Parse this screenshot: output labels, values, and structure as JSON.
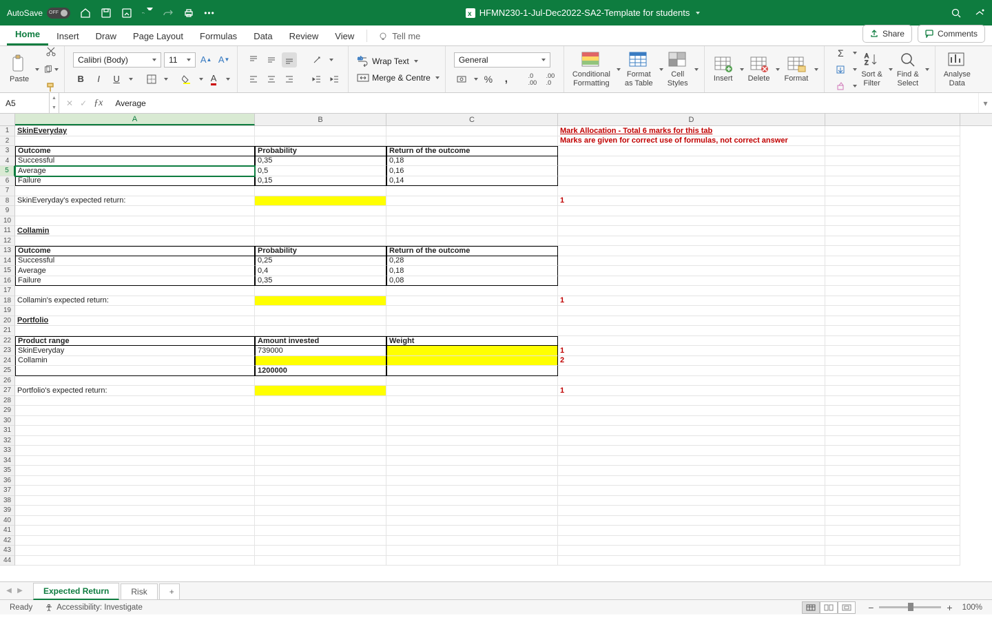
{
  "titlebar": {
    "autosave_label": "AutoSave",
    "autosave_state": "OFF",
    "doc_title": "HFMN230-1-Jul-Dec2022-SA2-Template for students"
  },
  "tabs": {
    "home": "Home",
    "insert": "Insert",
    "draw": "Draw",
    "page_layout": "Page Layout",
    "formulas": "Formulas",
    "data": "Data",
    "review": "Review",
    "view": "View",
    "tell_me": "Tell me",
    "share": "Share",
    "comments": "Comments"
  },
  "ribbon": {
    "paste": "Paste",
    "font_name": "Calibri (Body)",
    "font_size": "11",
    "wrap_text": "Wrap Text",
    "merge_centre": "Merge & Centre",
    "number_format": "General",
    "cond_fmt_l1": "Conditional",
    "cond_fmt_l2": "Formatting",
    "fmt_table_l1": "Format",
    "fmt_table_l2": "as Table",
    "cell_styles_l1": "Cell",
    "cell_styles_l2": "Styles",
    "insert": "Insert",
    "delete": "Delete",
    "format": "Format",
    "sort_filter_l1": "Sort &",
    "sort_filter_l2": "Filter",
    "find_select_l1": "Find &",
    "find_select_l2": "Select",
    "analyse_l1": "Analyse",
    "analyse_l2": "Data"
  },
  "namebox": "A5",
  "formula": "Average",
  "columns": [
    "A",
    "B",
    "C",
    "D"
  ],
  "col_widths": {
    "A": 348,
    "B": 191,
    "C": 249,
    "D": 388,
    "E": 196
  },
  "active_cell": {
    "row": 5,
    "col": "A"
  },
  "cells": {
    "r1": {
      "A": "SkinEveryday",
      "D": "Mark Allocation - Total 6 marks for this tab"
    },
    "r2": {
      "D": "Marks are given for correct use of formulas, not correct answer"
    },
    "r3": {
      "A": "Outcome",
      "B": "Probability",
      "C": "Return of the outcome"
    },
    "r4": {
      "A": "Successful",
      "B": "0,35",
      "C": "0,18"
    },
    "r5": {
      "A": "Average",
      "B": "0,5",
      "C": "0,16"
    },
    "r6": {
      "A": "Failure",
      "B": "0,15",
      "C": "0,14"
    },
    "r8": {
      "A": "SkinEveryday's expected return:",
      "D": "1"
    },
    "r11": {
      "A": "Collamin"
    },
    "r13": {
      "A": "Outcome",
      "B": "Probability",
      "C": "Return of the outcome"
    },
    "r14": {
      "A": "Successful",
      "B": "0,25",
      "C": "0,28"
    },
    "r15": {
      "A": "Average",
      "B": "0,4",
      "C": "0,18"
    },
    "r16": {
      "A": "Failure",
      "B": "0,35",
      "C": "0,08"
    },
    "r18": {
      "A": "Collamin's expected return:",
      "D": "1"
    },
    "r20": {
      "A": "Portfolio"
    },
    "r22": {
      "A": "Product range",
      "B": "Amount invested",
      "C": "Weight"
    },
    "r23": {
      "A": "SkinEveryday",
      "B": "739000",
      "D": "1"
    },
    "r24": {
      "A": "Collamin",
      "D": "2"
    },
    "r25": {
      "B": "1200000"
    },
    "r27": {
      "A": "Portfolio's expected return:",
      "D": "1"
    }
  },
  "sheet_tabs": {
    "active": "Expected Return",
    "other": "Risk"
  },
  "statusbar": {
    "ready": "Ready",
    "accessibility": "Accessibility: Investigate",
    "zoom": "100%"
  }
}
